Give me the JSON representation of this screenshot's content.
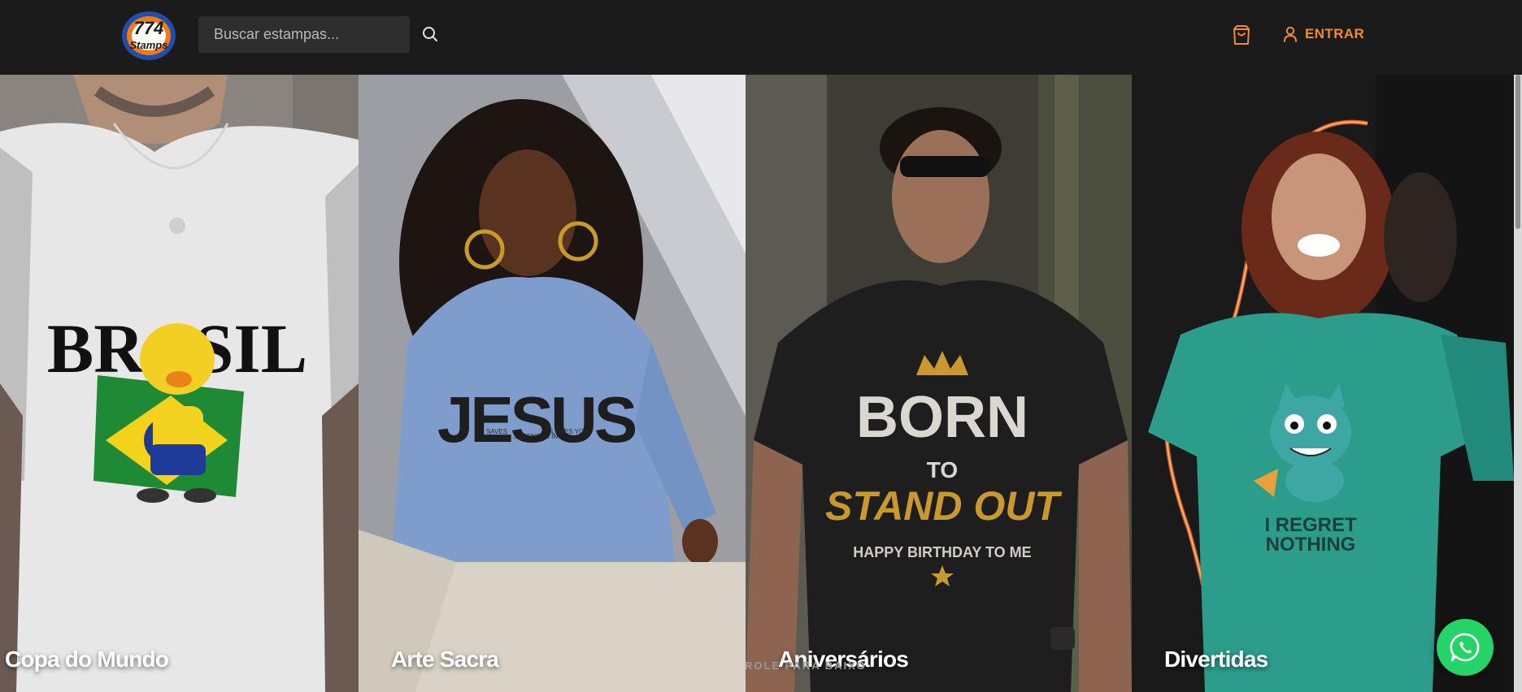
{
  "header": {
    "logo_text_top": "774",
    "logo_text_bottom": "Stamps",
    "search": {
      "placeholder": "Buscar estampas..."
    },
    "search_icon": "search-icon",
    "cart_icon": "shopping-bag-icon",
    "login": {
      "label": "ENTRAR",
      "icon": "user-icon"
    }
  },
  "categories": [
    {
      "label": "Copa do Mundo",
      "shirt_text": "BRASIL"
    },
    {
      "label": "Arte Sacra",
      "shirt_text": "JESUS",
      "shirt_small_top": "STRENGTH IN",
      "shirt_small_left": "SAVES",
      "shirt_small_right": "LOVES YOU"
    },
    {
      "label": "Aniversários",
      "shirt_text_1": "BORN",
      "shirt_text_2": "TO",
      "shirt_text_3": "STAND OUT",
      "shirt_text_4": "HAPPY BIRTHDAY TO ME"
    },
    {
      "label": "Divertidas",
      "shirt_text_1": "I REGRET",
      "shirt_text_2": "NOTHING"
    }
  ],
  "scroll_hint": "ROLE PARA BAIXO",
  "whatsapp_icon": "whatsapp-icon",
  "colors": {
    "header_bg": "#1b1b1b",
    "accent": "#f28a2e",
    "whatsapp": "#25d366"
  }
}
